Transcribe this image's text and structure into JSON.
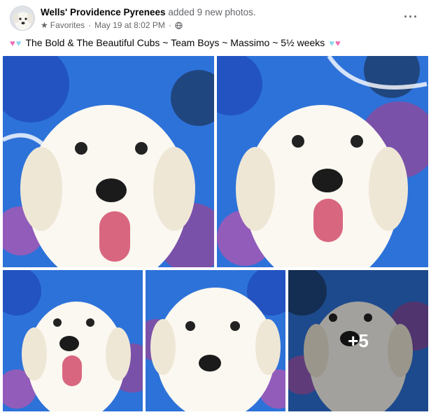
{
  "post": {
    "author": "Wells' Providence Pyrenees",
    "action": "added 9 new photos.",
    "audience": "Favorites",
    "timestamp": "May 19 at 8:02 PM",
    "more_label": "···",
    "caption": "The Bold & The Beautiful Cubs ~ Team Boys ~ Massimo ~ 5½ weeks",
    "extra_photos": "+5"
  },
  "colors": {
    "pink_heart": "#f06fb4",
    "blue_heart": "#8fd6f0",
    "background_blue": "#2b6fd6"
  }
}
